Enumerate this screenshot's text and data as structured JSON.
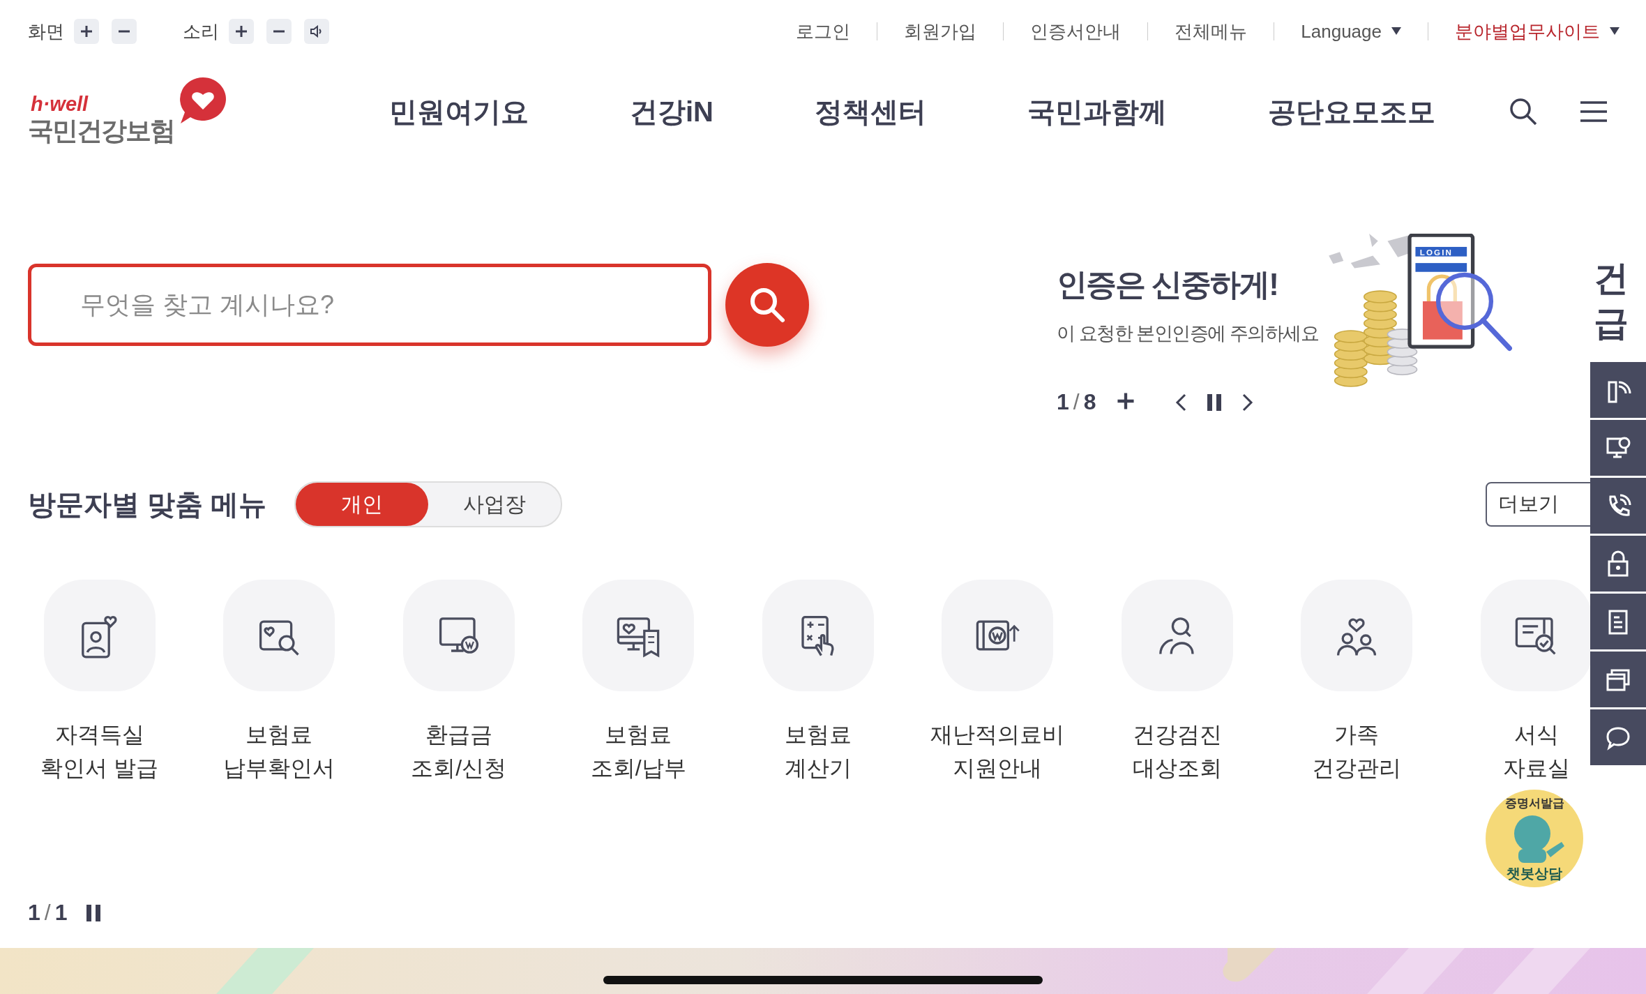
{
  "utility_bar": {
    "screen_label": "화면",
    "sound_label": "소리",
    "links": [
      {
        "label": "로그인",
        "kind": "link"
      },
      {
        "label": "회원가입",
        "kind": "link"
      },
      {
        "label": "인증서안내",
        "kind": "link"
      },
      {
        "label": "전체메뉴",
        "kind": "link"
      },
      {
        "label": "Language",
        "kind": "dropdown"
      },
      {
        "label": "분야별업무사이트",
        "kind": "highlight-dropdown"
      }
    ]
  },
  "logo": {
    "tagline": "h·well",
    "name": "국민건강보험"
  },
  "nav": [
    "민원여기요",
    "건강iN",
    "정책센터",
    "국민과함께",
    "공단요모조모"
  ],
  "search": {
    "placeholder": "무엇을 찾고 계시나요?"
  },
  "banner": {
    "title": "인증은 신중하게!",
    "subtitle": "이 요청한 본인인증에 주의하세요",
    "current": "1",
    "separator": "/",
    "total": "8",
    "next_title_lines": [
      "건",
      "급"
    ],
    "illustration_label": "LOGIN"
  },
  "visitor_menu": {
    "title": "방문자별 맞춤 메뉴",
    "tabs": [
      {
        "label": "개인",
        "selected": true
      },
      {
        "label": "사업장",
        "selected": false
      }
    ],
    "more": "더보기",
    "items": [
      {
        "lines": [
          "자격득실",
          "확인서 발급"
        ]
      },
      {
        "lines": [
          "보험료",
          "납부확인서"
        ]
      },
      {
        "lines": [
          "환급금",
          "조회/신청"
        ]
      },
      {
        "lines": [
          "보험료",
          "조회/납부"
        ]
      },
      {
        "lines": [
          "보험료",
          "계산기"
        ]
      },
      {
        "lines": [
          "재난적의료비",
          "지원안내"
        ]
      },
      {
        "lines": [
          "건강검진",
          "대상조회"
        ]
      },
      {
        "lines": [
          "가족",
          "건강관리"
        ]
      },
      {
        "lines": [
          "서식",
          "자료실"
        ]
      }
    ],
    "pager": {
      "current": "1",
      "separator": "/",
      "total": "1"
    }
  },
  "chatbot": {
    "top_text": "증명서발급",
    "bottom_text": "챗봇상담"
  }
}
